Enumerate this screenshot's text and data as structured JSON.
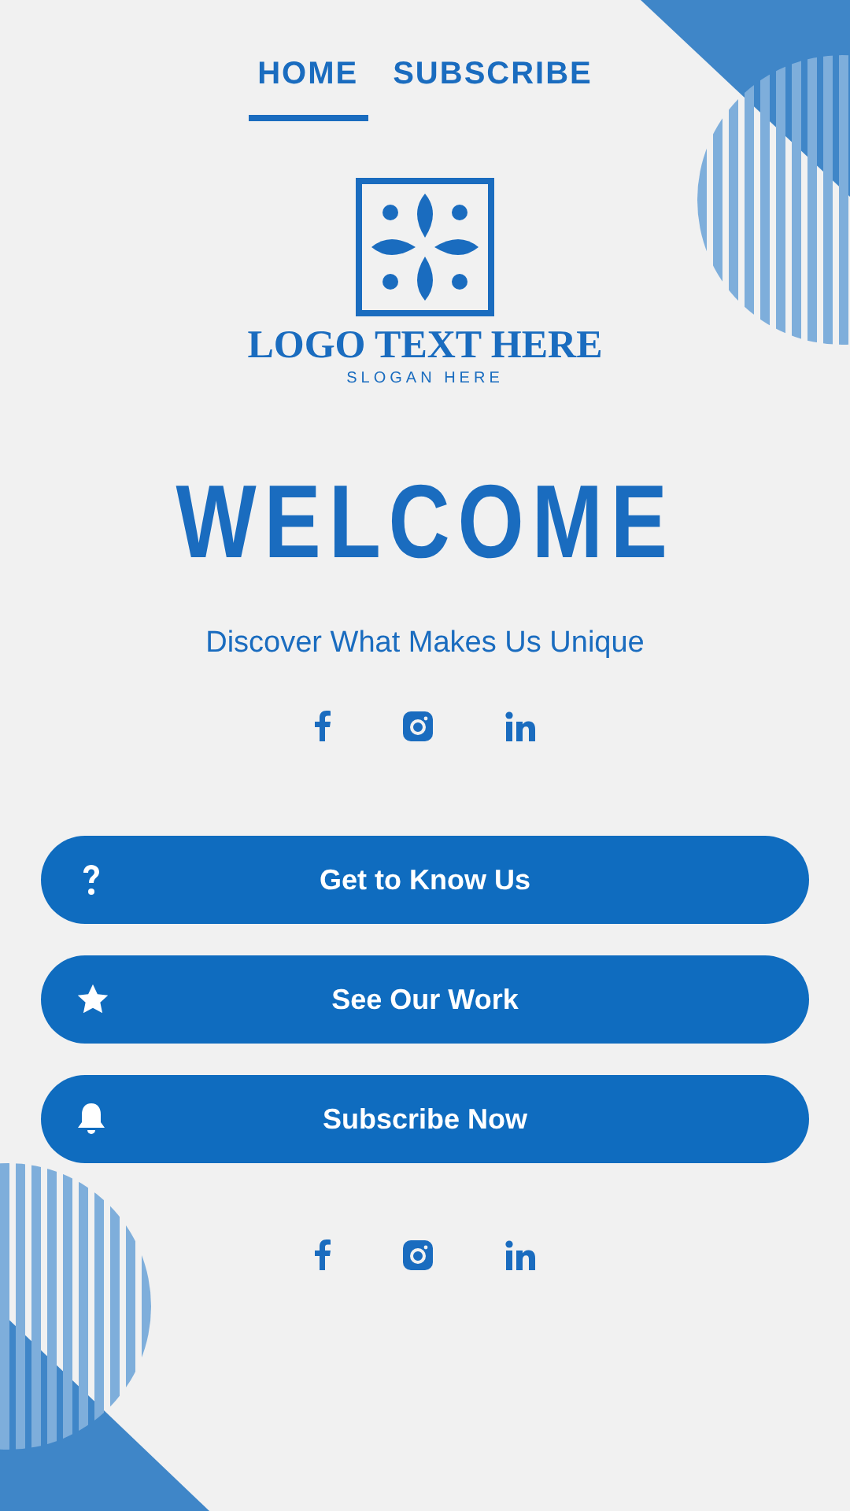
{
  "nav": [
    {
      "label": "HOME",
      "selected": true
    },
    {
      "label": "SUBSCRIBE",
      "selected": false
    }
  ],
  "logo": {
    "name": "LOGO TEXT HERE",
    "slogan": "SLOGAN HERE"
  },
  "title": "WELCOME",
  "subtitle": "Discover What Makes Us Unique",
  "social_top": [
    {
      "kind": "facebook"
    },
    {
      "kind": "instagram"
    },
    {
      "kind": "linkedin"
    }
  ],
  "buttons": [
    {
      "label": "Get to Know Us",
      "kind": "question"
    },
    {
      "label": "See Our Work",
      "kind": "star"
    },
    {
      "label": "Subscribe Now",
      "kind": "bell"
    }
  ],
  "social_bottom": [
    {
      "kind": "facebook"
    },
    {
      "kind": "instagram"
    },
    {
      "kind": "linkedin"
    }
  ]
}
